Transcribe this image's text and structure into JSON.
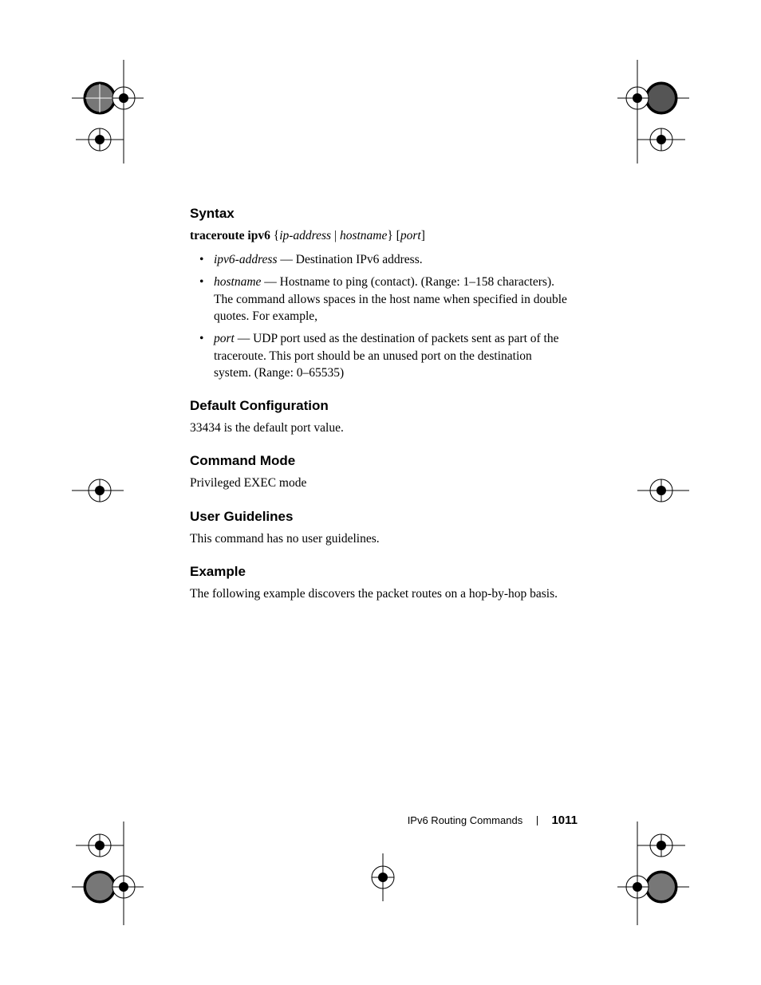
{
  "headings": {
    "syntax": "Syntax",
    "defaultConfig": "Default Configuration",
    "commandMode": "Command Mode",
    "userGuidelines": "User Guidelines",
    "example": "Example"
  },
  "syntax": {
    "command": "traceroute ipv6",
    "arg1": "ip-address",
    "pipe": " | ",
    "arg2": "hostname",
    "arg3": "port"
  },
  "params": {
    "p1Term": "ipv6-address",
    "p1Desc": " — Destination IPv6 address.",
    "p2Term": "hostname",
    "p2Desc": " — Hostname to ping (contact). (Range: 1–158 characters). The command allows spaces in the host name when specified in double quotes. For example,",
    "p3Term": "port",
    "p3Desc": " — UDP port used as the destination of packets sent as part of the traceroute. This port should be an unused port on the destination system. (Range: 0–65535)"
  },
  "body": {
    "defaultConfig": "33434 is the default port value.",
    "commandMode": "Privileged EXEC mode",
    "userGuidelines": "This command has no user guidelines.",
    "example": "The following example discovers the packet routes on a hop-by-hop basis."
  },
  "footer": {
    "section": "IPv6 Routing Commands",
    "page": "1011"
  }
}
